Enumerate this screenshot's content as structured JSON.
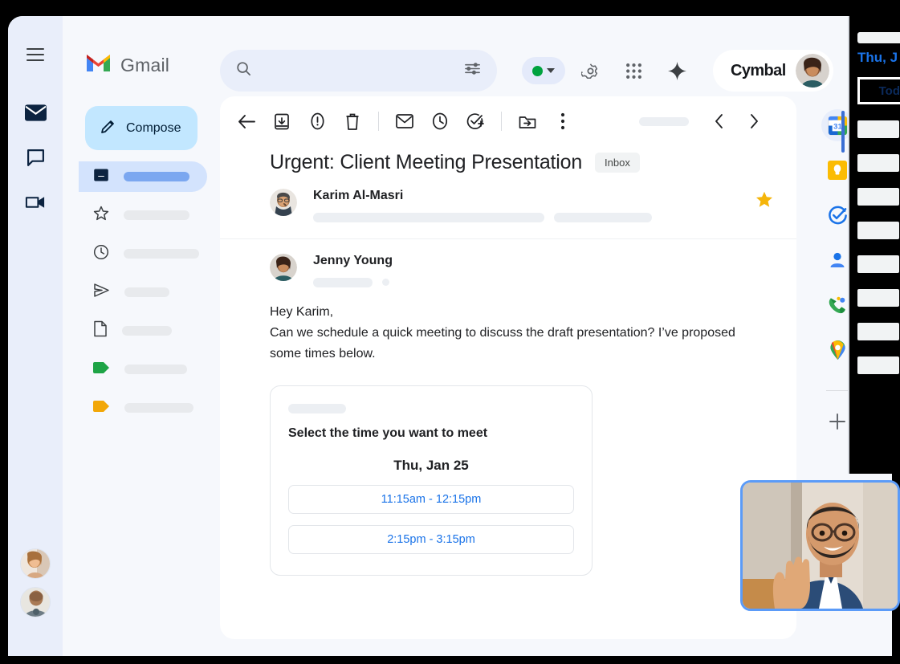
{
  "window": {
    "bg_color": "#f6f8fc",
    "outer_bg": "#000000"
  },
  "rail": {
    "hamburger": "menu-icon",
    "items": [
      {
        "name": "mail",
        "icon": "mail-icon",
        "active": true
      },
      {
        "name": "chat",
        "icon": "chat-icon",
        "active": false
      },
      {
        "name": "meet",
        "icon": "video-camera-icon",
        "active": false
      }
    ]
  },
  "header": {
    "brand": "Gmail",
    "logo": "gmail-m-logo",
    "search": {
      "value": "",
      "placeholder": "",
      "icon": "search-icon",
      "filter_icon": "tune-icon"
    },
    "status_chip": {
      "dot_color": "#00a23e",
      "caret": "chevron-down-icon"
    },
    "settings_icon": "gear-icon",
    "apps_icon": "grid-apps-icon",
    "gemini_icon": "sparkle-icon",
    "account": {
      "name": "Cymbal",
      "avatar": "woman-avatar"
    }
  },
  "nav": {
    "compose": {
      "label": "Compose",
      "icon": "pencil-icon",
      "bg": "#c2e7ff"
    },
    "items": [
      {
        "icon": "inbox-icon",
        "active": true,
        "ph_width": 82
      },
      {
        "icon": "star-outline-icon",
        "active": false,
        "ph_width": 82
      },
      {
        "icon": "clock-icon",
        "active": false,
        "ph_width": 94
      },
      {
        "icon": "send-icon",
        "active": false,
        "ph_width": 56
      },
      {
        "icon": "draft-document-icon",
        "active": false,
        "ph_width": 62
      },
      {
        "icon": "label-green-icon",
        "active": false,
        "ph_width": 78
      },
      {
        "icon": "label-yellow-icon",
        "active": false,
        "ph_width": 86
      }
    ]
  },
  "mail_toolbar": {
    "back": "back-arrow-icon",
    "archive": "archive-icon",
    "report_spam": "report-spam-icon",
    "delete": "trash-icon",
    "mark_unread": "envelope-icon",
    "snooze": "clock-icon",
    "add_task": "check-circle-plus-icon",
    "move_to": "move-to-folder-icon",
    "more": "more-vert-icon",
    "prev": "chevron-left-icon",
    "next": "chevron-right-icon"
  },
  "email": {
    "subject": "Urgent: Client Meeting Presentation",
    "label_badge": "Inbox",
    "messages": [
      {
        "sender": "Karim Al-Masri",
        "avatar": "man-avatar",
        "starred": true,
        "star_color": "#f5b50a"
      },
      {
        "sender": "Jenny Young",
        "avatar": "woman-avatar",
        "starred": false
      }
    ],
    "body_lines": [
      "Hey Karim,",
      "Can we schedule a quick meeting to discuss the draft presentation? I’ve proposed some times below."
    ]
  },
  "time_card": {
    "title": "Select the time you want to meet",
    "date": "Thu, Jan 25",
    "slots": [
      "11:15am - 12:15pm",
      "2:15pm - 3:15pm"
    ],
    "slot_color": "#1a73e8"
  },
  "side_apps": [
    {
      "name": "google-calendar",
      "icon": "calendar-31-icon",
      "active": true
    },
    {
      "name": "google-keep",
      "icon": "keep-bulb-icon",
      "active": false
    },
    {
      "name": "google-tasks",
      "icon": "tasks-check-icon",
      "active": false
    },
    {
      "name": "google-contacts",
      "icon": "contacts-person-icon",
      "active": false
    },
    {
      "name": "google-voice",
      "icon": "voice-phone-icon",
      "active": false
    },
    {
      "name": "google-maps",
      "icon": "maps-pin-icon",
      "active": false
    }
  ],
  "side_apps_add": {
    "icon": "plus-icon"
  },
  "calendar_overlay": {
    "date_text": "Thu, J",
    "today_text": "Tod",
    "slot_count": 8
  },
  "video_pip": {
    "participant": "man-waving",
    "border_color": "#5b9bf8"
  }
}
